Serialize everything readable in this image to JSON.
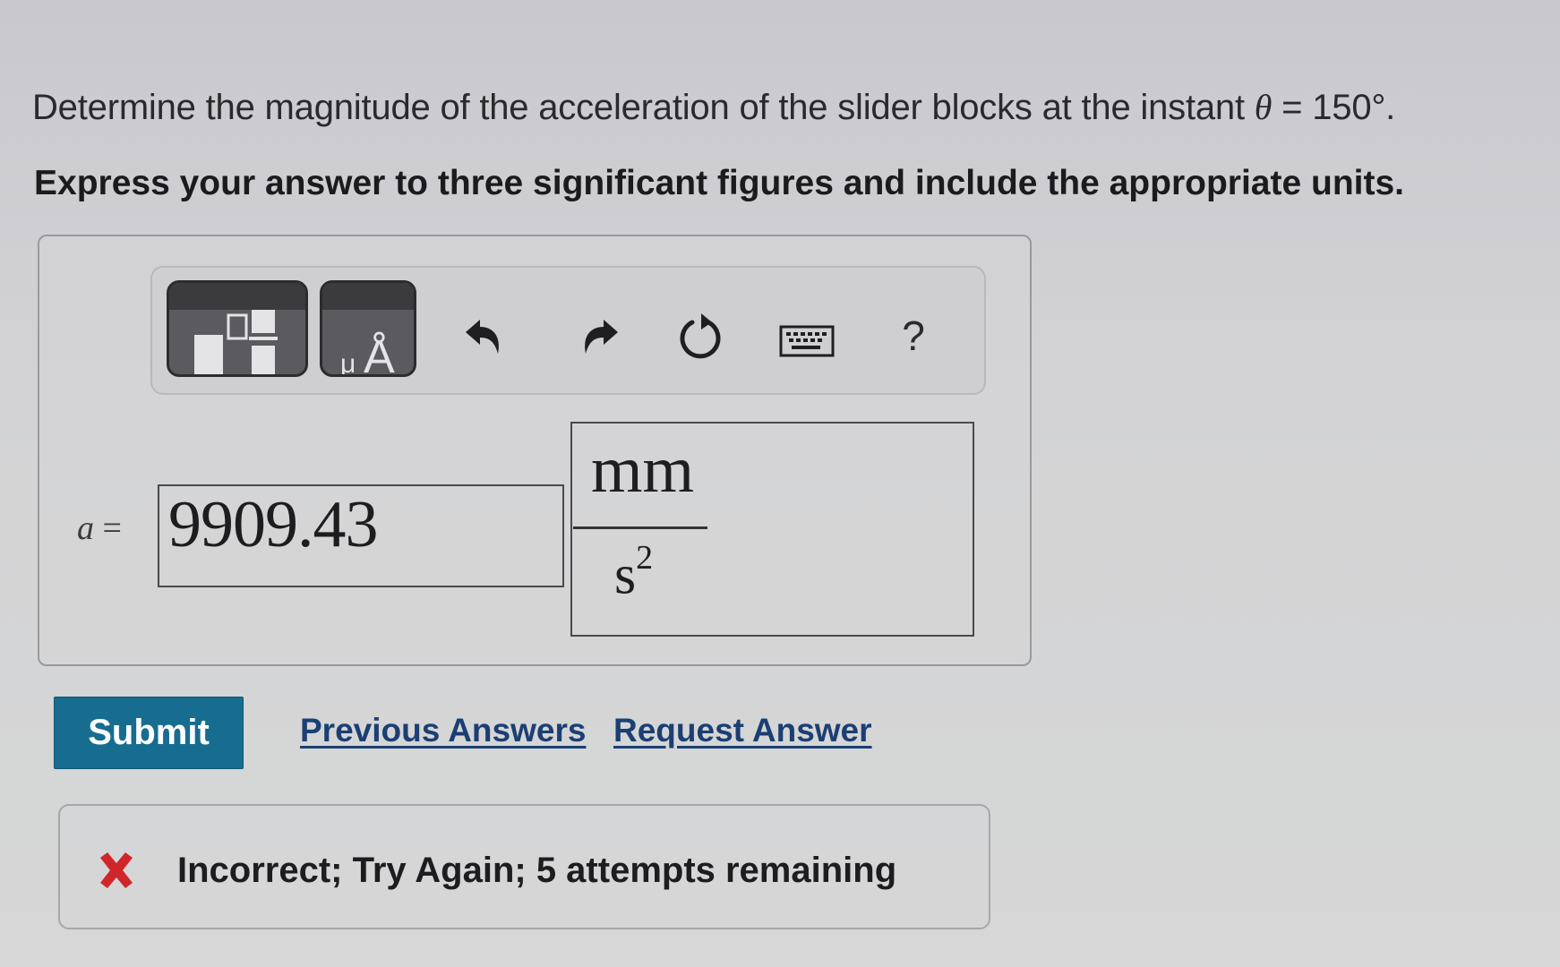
{
  "question": {
    "prompt_before": "Determine the magnitude of the acceleration of the slider blocks at the instant ",
    "theta_symbol": "θ",
    "prompt_after": " = 150°.",
    "instruction": "Express your answer to three significant figures and include the appropriate units."
  },
  "toolbar": {
    "items": [
      {
        "name": "templates-button",
        "icon": "fraction-template-icon"
      },
      {
        "name": "units-button",
        "icon": "units-mu-angstrom-icon",
        "label": "μÅ"
      },
      {
        "name": "undo-button",
        "icon": "undo-arrow-icon"
      },
      {
        "name": "redo-button",
        "icon": "redo-arrow-icon"
      },
      {
        "name": "reset-button",
        "icon": "reset-circular-arrow-icon"
      },
      {
        "name": "keyboard-button",
        "icon": "keyboard-icon"
      },
      {
        "name": "help-button",
        "icon": "help-question-icon",
        "label": "?"
      }
    ],
    "units_label": "μÅ",
    "help_label": "?"
  },
  "answer": {
    "variable": "a",
    "equals": "=",
    "value": "9909.43",
    "unit_numerator": "mm",
    "unit_denominator_base": "s",
    "unit_denominator_exponent": "2"
  },
  "actions": {
    "submit_label": "Submit",
    "previous_answers_label": "Previous Answers",
    "request_answer_label": "Request Answer"
  },
  "feedback": {
    "status": "incorrect",
    "icon": "red-x-icon",
    "message": "Incorrect; Try Again; 5 attempts remaining",
    "attempts_remaining": 5
  },
  "colors": {
    "submit_bg": "#166d8f",
    "link": "#1b3f73",
    "error_x": "#d0262b",
    "toolbar_button_bg": "#5b5b5f"
  }
}
